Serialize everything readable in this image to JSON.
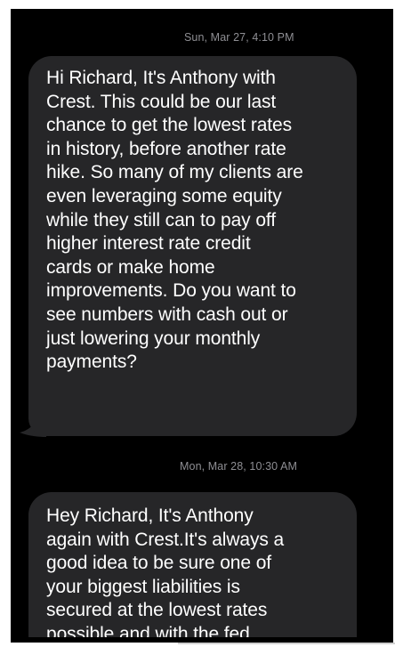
{
  "conversation": {
    "messages": [
      {
        "timestamp": "Sun, Mar 27, 4:10 PM",
        "lines": [
          "Hi Richard,  It's Anthony with",
          "Crest. This could be our last",
          "chance to get the lowest rates",
          "in history, before another rate",
          "hike. So many of my clients are",
          "even leveraging some equity",
          "while they still can to pay off",
          "higher interest rate credit",
          "cards or make home",
          "improvements. Do you want to",
          "see numbers with cash out or",
          "just lowering your monthly",
          "payments?"
        ]
      },
      {
        "timestamp": "Mon, Mar 28, 10:30 AM",
        "lines": [
          "Hey Richard,  It's Anthony",
          "again with Crest.It's always a",
          "good idea to be sure one of",
          "your biggest liabilities is",
          "secured at the lowest rates",
          "possible and with the fed"
        ]
      }
    ]
  },
  "colors": {
    "background": "#000000",
    "bubble": "#262628",
    "timestamp": "#8e8e93",
    "text": "#ffffff"
  }
}
